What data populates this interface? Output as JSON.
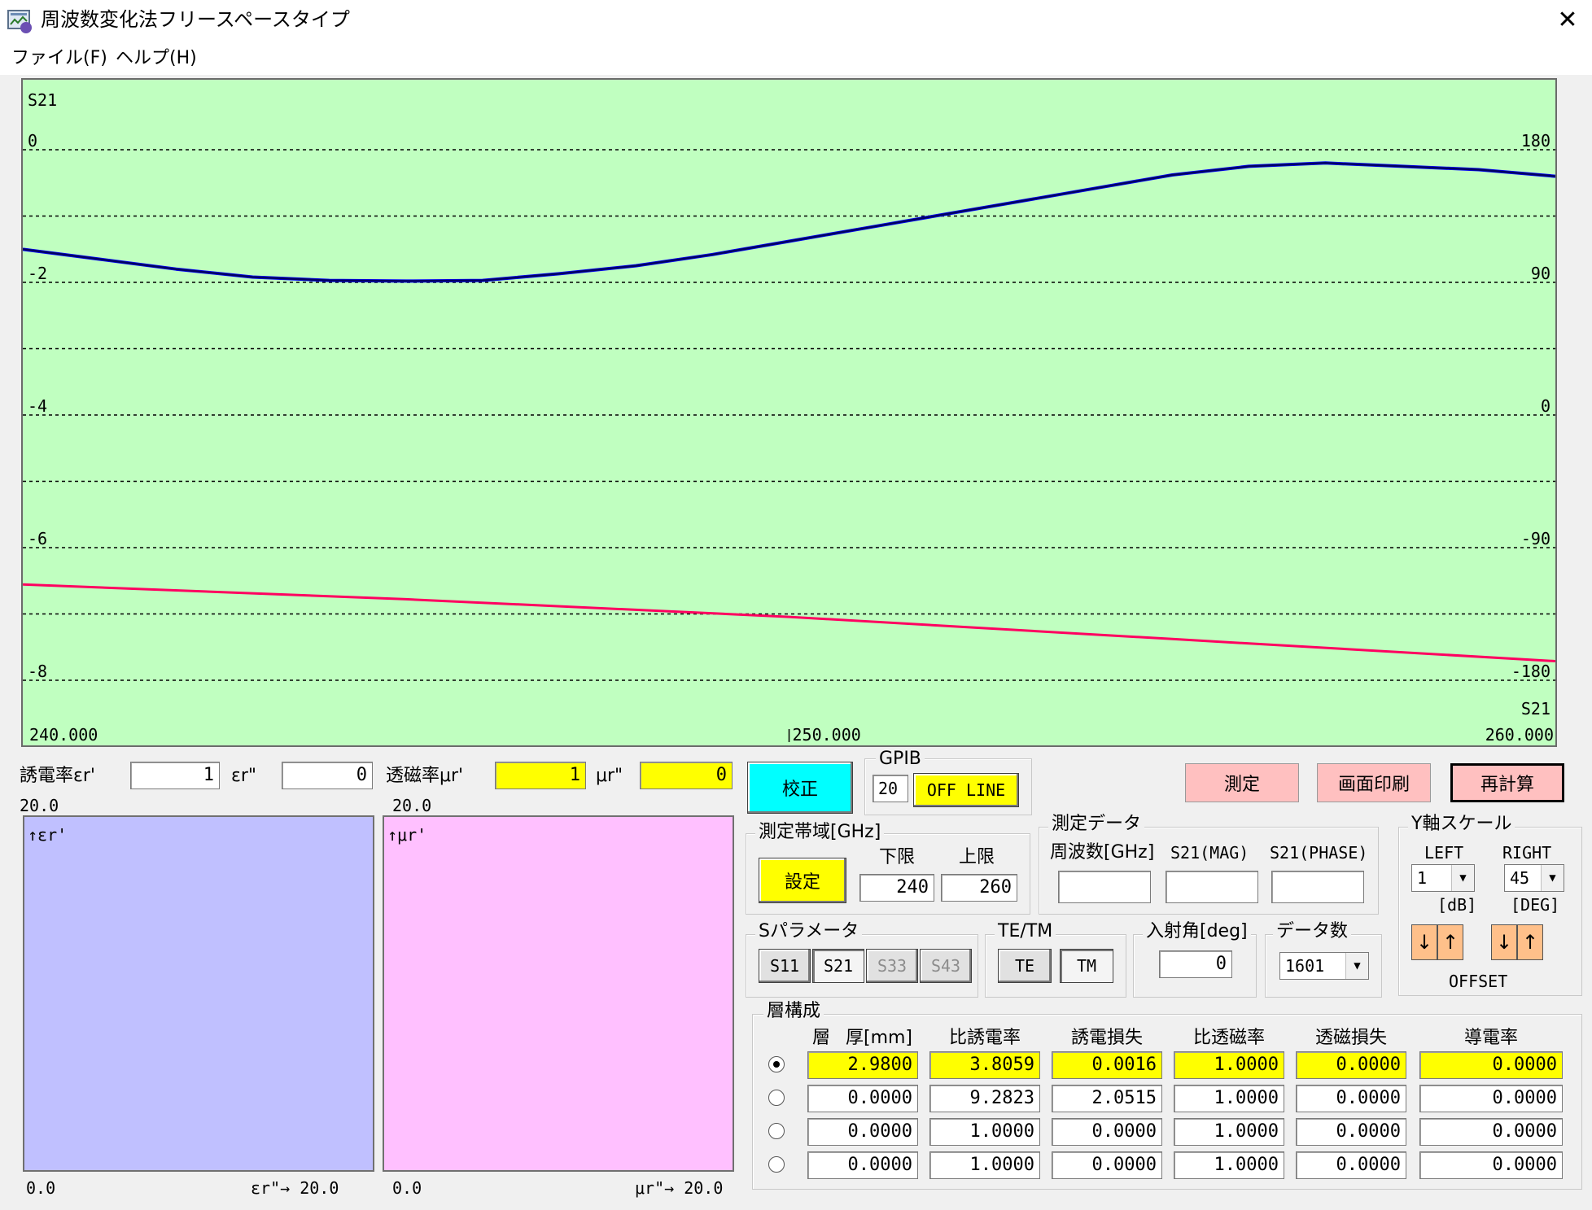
{
  "window": {
    "title": "周波数変化法フリースペースタイプ",
    "close_glyph": "✕"
  },
  "menu": [
    {
      "label": "ファイル(F)"
    },
    {
      "label": "ヘルプ(H)"
    }
  ],
  "chart_data": {
    "type": "line",
    "corner_label_top": "S21",
    "corner_label_bottom": "S21",
    "x_ticks": [
      "240.000",
      "250.000",
      "260.000"
    ],
    "xlim": [
      240,
      260
    ],
    "left_axis": {
      "unit": "dB",
      "ylim": [
        -8,
        0
      ],
      "ticks": [
        "0",
        "-2",
        "-4",
        "-6",
        "-8"
      ]
    },
    "right_axis": {
      "unit": "DEG",
      "ylim": [
        -180,
        180
      ],
      "ticks": [
        "180",
        "90",
        "0",
        "-90",
        "-180"
      ]
    },
    "grid": true,
    "series": [
      {
        "axis": "left",
        "color": "#000060",
        "x": [
          240,
          241,
          242,
          243,
          244,
          245,
          246,
          247,
          248,
          249,
          250,
          251,
          252,
          253,
          254,
          255,
          256,
          257,
          258,
          259,
          260
        ],
        "y": [
          -1.5,
          -1.65,
          -1.8,
          -1.92,
          -1.97,
          -1.98,
          -1.97,
          -1.87,
          -1.75,
          -1.58,
          -1.38,
          -1.18,
          -0.98,
          -0.78,
          -0.58,
          -0.38,
          -0.25,
          -0.2,
          -0.25,
          -0.3,
          -0.4
        ]
      },
      {
        "axis": "right",
        "color": "#ff0060",
        "x": [
          240,
          245,
          250,
          255,
          260
        ],
        "y": [
          -115,
          -125,
          -137,
          -152,
          -167
        ]
      }
    ]
  },
  "er_row": {
    "label": "誘電率εr'",
    "er1": "1",
    "er2_label": "εr\"",
    "er2": "0",
    "scale": "20.0",
    "chart_label": "↑εr'",
    "origin": "0.0",
    "x_label": "εr\"→ 20.0"
  },
  "mu_row": {
    "label": "透磁率μr'",
    "mu1": "1",
    "mu2_label": "μr\"",
    "mu2": "0",
    "scale": "20.0",
    "chart_label": "↑μr'",
    "origin": "0.0",
    "x_label": "μr\"→ 20.0"
  },
  "buttons": {
    "calibrate": "校正",
    "measure": "測定",
    "print": "画面印刷",
    "recalc": "再計算",
    "set": "設定"
  },
  "gpib": {
    "title": "GPIB",
    "address": "20",
    "status": "OFF LINE"
  },
  "band": {
    "title": "測定帯域[GHz]",
    "lower_label": "下限",
    "upper_label": "上限",
    "lower": "240",
    "upper": "260"
  },
  "meas_data": {
    "title": "測定データ",
    "freq_label": "周波数[GHz]",
    "mag_label": "S21(MAG)",
    "phase_label": "S21(PHASE)",
    "freq": "",
    "mag": "",
    "phase": ""
  },
  "yscale": {
    "title": "Y軸スケール",
    "left_label": "LEFT",
    "right_label": "RIGHT",
    "left_value": "1",
    "right_value": "45",
    "left_unit": "[dB]",
    "right_unit": "[DEG]",
    "offset_label": "OFFSET",
    "down": "↓",
    "up": "↑",
    "dropdown": "▼"
  },
  "sparam": {
    "title": "Sパラメータ",
    "s11": "S11",
    "s21": "S21",
    "s33": "S33",
    "s43": "S43",
    "selected": "S21"
  },
  "tetm": {
    "title": "TE/TM",
    "te": "TE",
    "tm": "TM",
    "selected": "TM"
  },
  "angle": {
    "title": "入射角[deg]",
    "value": "0"
  },
  "count": {
    "title": "データ数",
    "value": "1601"
  },
  "layers": {
    "title": "層構成",
    "headers": [
      "層",
      "厚[mm]",
      "比誘電率",
      "誘電損失",
      "比透磁率",
      "透磁損失",
      "導電率"
    ],
    "selected": 0,
    "rows": [
      [
        "2.9800",
        "3.8059",
        "0.0016",
        "1.0000",
        "0.0000",
        "0.0000"
      ],
      [
        "0.0000",
        "9.2823",
        "2.0515",
        "1.0000",
        "0.0000",
        "0.0000"
      ],
      [
        "0.0000",
        "1.0000",
        "0.0000",
        "1.0000",
        "0.0000",
        "0.0000"
      ],
      [
        "0.0000",
        "1.0000",
        "0.0000",
        "1.0000",
        "0.0000",
        "0.0000"
      ]
    ]
  }
}
